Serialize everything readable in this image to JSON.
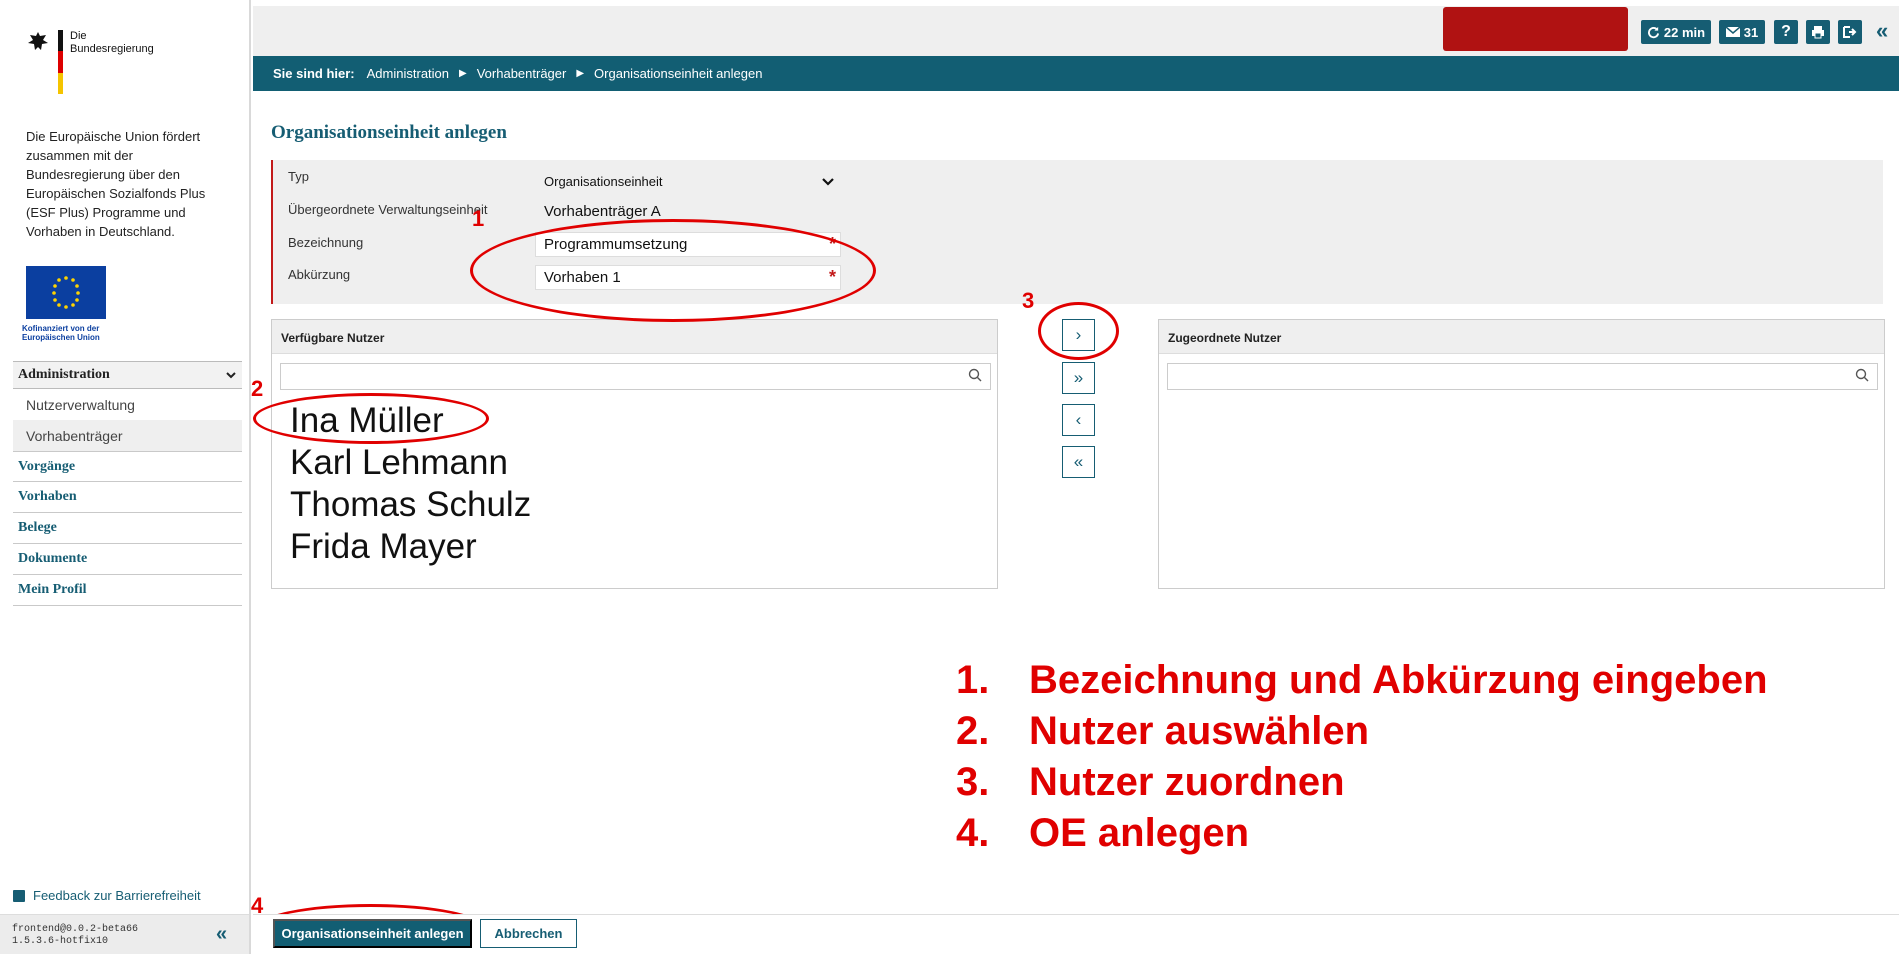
{
  "logo": {
    "text_line1": "Die",
    "text_line2": "Bundesregierung"
  },
  "sidebar": {
    "eu_text": "Die Europäische Union fördert zusammen mit der Bundesregierung über den Europäischen Sozialfonds Plus (ESF Plus) Programme und Vorhaben in Deutschland.",
    "eu_caption_line1": "Kofinanziert von der",
    "eu_caption_line2": "Europäischen Union",
    "section": "Administration",
    "subitems": [
      "Nutzerverwaltung",
      "Vorhabenträger"
    ],
    "items": [
      "Vorgänge",
      "Vorhaben",
      "Belege",
      "Dokumente",
      "Mein Profil"
    ],
    "feedback": "Feedback zur Barrierefreiheit",
    "version_line1": "frontend@0.0.2-beta66",
    "version_line2": "1.5.3.6-hotfix10"
  },
  "topbar": {
    "session_timer": "22 min",
    "messages_count": "31"
  },
  "breadcrumb": {
    "label": "Sie sind hier:",
    "items": [
      "Administration",
      "Vorhabenträger",
      "Organisationseinheit anlegen"
    ]
  },
  "page": {
    "title": "Organisationseinheit anlegen"
  },
  "form": {
    "typ_label": "Typ",
    "typ_value": "Organisationseinheit",
    "parent_label": "Übergeordnete Verwaltungseinheit",
    "parent_value": "Vorhabenträger A",
    "bezeichnung_label": "Bezeichnung",
    "bezeichnung_value": "Programmumsetzung",
    "abkuerzung_label": "Abkürzung",
    "abkuerzung_value": "Vorhaben 1",
    "required_mark": "*"
  },
  "available_users": {
    "title": "Verfügbare Nutzer",
    "users": [
      "Ina Müller",
      "Karl Lehmann",
      "Thomas Schulz",
      "Frida Mayer"
    ]
  },
  "assigned_users": {
    "title": "Zugeordnete Nutzer"
  },
  "move_buttons": {
    "add_one": "›",
    "add_all": "»",
    "remove_one": "‹",
    "remove_all": "«"
  },
  "annotations": {
    "markers": [
      "1",
      "2",
      "3",
      "4"
    ],
    "steps": [
      {
        "n": "1.",
        "text": "Bezeichnung und Abkürzung eingeben"
      },
      {
        "n": "2.",
        "text": "Nutzer auswählen"
      },
      {
        "n": "3.",
        "text": "Nutzer zuordnen"
      },
      {
        "n": "4.",
        "text": "OE anlegen"
      }
    ]
  },
  "footer": {
    "create_label": "Organisationseinheit anlegen",
    "cancel_label": "Abbrechen"
  },
  "colors": {
    "primary": "#125e73",
    "annotation_red": "#e00000",
    "required_red": "#c21a1a"
  }
}
